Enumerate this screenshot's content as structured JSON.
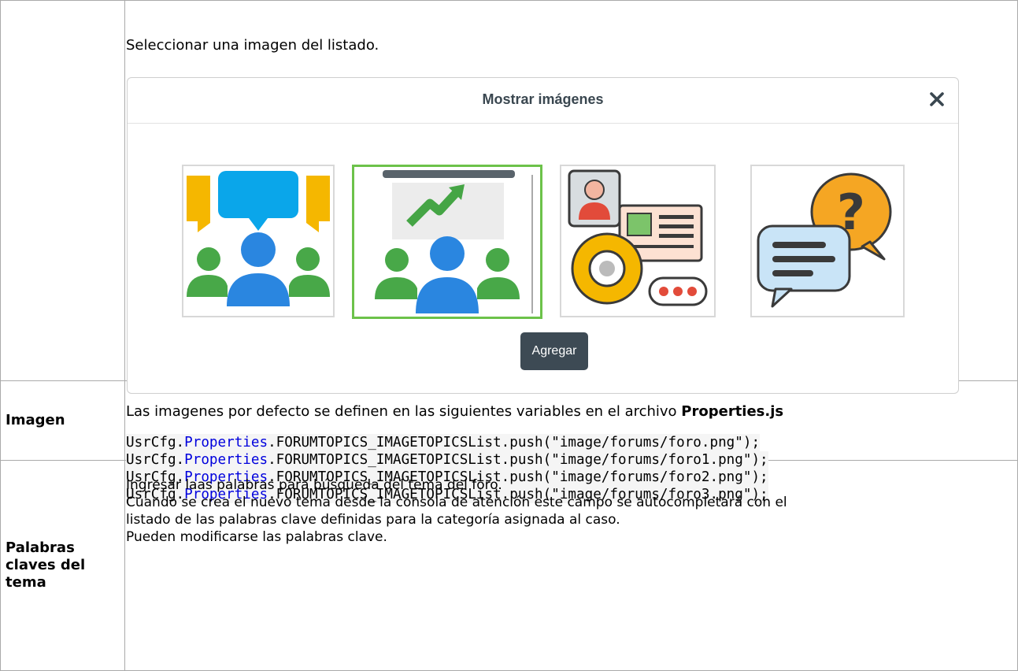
{
  "image_row": {
    "label": "Imagen",
    "intro": "Seleccionar una imagen del listado.",
    "modal": {
      "title": "Mostrar imágenes",
      "close_icon": "close-icon",
      "thumbnails": [
        {
          "icon": "group-discussion-icon",
          "selected": false
        },
        {
          "icon": "presentation-chart-icon",
          "selected": true
        },
        {
          "icon": "support-settings-icon",
          "selected": false
        },
        {
          "icon": "chat-question-icon",
          "selected": false
        }
      ],
      "add_button": "Agregar"
    },
    "desc_prefix": "Las imagenes por defecto se definen en las siguientes variables en el archivo ",
    "desc_file": "Properties.js",
    "code": [
      {
        "prefix": "UsrCfg.",
        "prop": "Properties",
        "suffix": ".FORUMTOPICS_IMAGETOPICSList.push(\"image/forums/foro.png\");"
      },
      {
        "prefix": "UsrCfg.",
        "prop": "Properties",
        "suffix": ".FORUMTOPICS_IMAGETOPICSList.push(\"image/forums/foro1.png\");"
      },
      {
        "prefix": "UsrCfg.",
        "prop": "Properties",
        "suffix": ".FORUMTOPICS_IMAGETOPICSList.push(\"image/forums/foro2.png\");"
      },
      {
        "prefix": "UsrCfg.",
        "prop": "Properties",
        "suffix": ".FORUMTOPICS_IMAGETOPICSList.push(\"image/forums/foro3.png\");"
      }
    ]
  },
  "keywords_row": {
    "label": "Palabras claves del tema",
    "lines": [
      "Ingresar laas palabras para búsqueda del tema del foro.",
      "Cuando se crea el nuevo tema desde la consola de atención este campo se autocompletará con el",
      "listado de las palabras clave definidas para la categoría asignada al caso.",
      "Pueden modificarse las palabras clave."
    ]
  },
  "colors": {
    "selected_border": "#6cc24a",
    "button_bg": "#3d4a54",
    "code_property": "#0000dd"
  }
}
